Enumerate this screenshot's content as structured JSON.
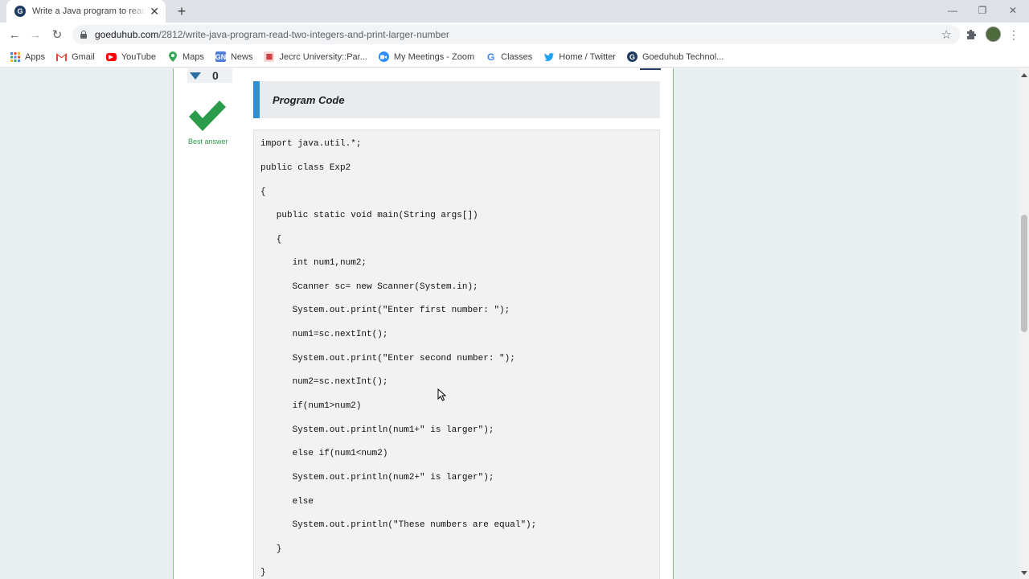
{
  "browser": {
    "tab_title": "Write a Java program to read two integers and print larger number",
    "tab_favicon": "G",
    "url_domain": "goeduhub.com",
    "url_path": "/2812/write-java-program-read-two-integers-and-print-larger-number"
  },
  "bookmarks": [
    {
      "label": "Apps",
      "icon": "apps-grid-icon"
    },
    {
      "label": "Gmail",
      "icon": "gmail-icon"
    },
    {
      "label": "YouTube",
      "icon": "youtube-icon"
    },
    {
      "label": "Maps",
      "icon": "maps-pin-icon"
    },
    {
      "label": "News",
      "icon": "news-icon"
    },
    {
      "label": "Jecrc University::Par...",
      "icon": "jecrc-icon"
    },
    {
      "label": "My Meetings - Zoom",
      "icon": "zoom-icon"
    },
    {
      "label": "Classes",
      "icon": "google-icon"
    },
    {
      "label": "Home / Twitter",
      "icon": "twitter-icon"
    },
    {
      "label": "Goeduhub Technol...",
      "icon": "goeduhub-icon"
    }
  ],
  "answer": {
    "vote_count": "0",
    "best_answer_label": "Best answer"
  },
  "section_heading": "Program Code",
  "code_lines": [
    "import java.util.*;",
    "public class Exp2",
    "{",
    "   public static void main(String args[])",
    "   {",
    "      int num1,num2;",
    "      Scanner sc= new Scanner(System.in);",
    "      System.out.print(\"Enter first number: \");",
    "      num1=sc.nextInt();",
    "      System.out.print(\"Enter second number: \");",
    "      num2=sc.nextInt();",
    "      if(num1>num2)",
    "      System.out.println(num1+\" is larger\");",
    "      else if(num1<num2)",
    "      System.out.println(num2+\" is larger\");",
    "      else",
    "      System.out.println(\"These numbers are equal\");",
    "   }",
    "}"
  ],
  "colors": {
    "accent_blue": "#2d8fd5",
    "best_answer_green": "#2a9b4a",
    "column_border": "#7cc47f"
  }
}
